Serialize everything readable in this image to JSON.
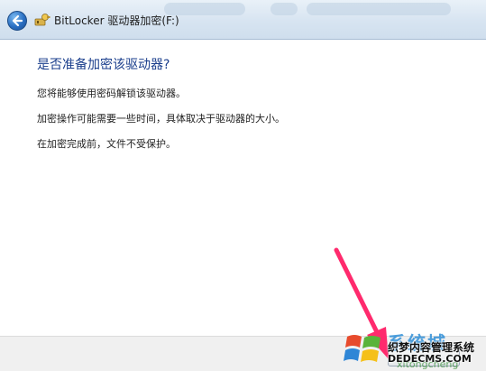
{
  "window": {
    "title": "BitLocker 驱动器加密(F:)",
    "icon": "bitlocker-key-icon",
    "back_icon": "back-arrow-icon"
  },
  "main": {
    "heading": "是否准备加密该驱动器?",
    "paragraphs": [
      "您将能够使用密码解锁该驱动器。",
      "加密操作可能需要一些时间，具体取决于驱动器的大小。",
      "在加密完成前，文件不受保护。"
    ]
  },
  "annotation": {
    "arrow_color": "#ff2a6d"
  },
  "watermark": {
    "brand": "系统城",
    "site": "织梦内容管理系统",
    "url": "DEDECMS.COM",
    "url2": "xitongcheng"
  },
  "colors": {
    "heading": "#1a3e8c",
    "titlebar": "#d7e4f1"
  }
}
